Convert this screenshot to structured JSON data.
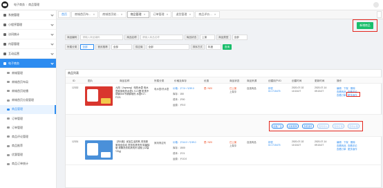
{
  "header": {
    "breadcrumb": [
      "电子商务",
      "商品管理"
    ]
  },
  "sidebar": {
    "items": [
      {
        "label": "系统管理"
      },
      {
        "label": "小程序管理"
      },
      {
        "label": "访问统计"
      },
      {
        "label": "内容管理"
      },
      {
        "label": "互动运营"
      },
      {
        "label": "电子商务"
      }
    ],
    "sub_items": [
      {
        "label": "商城管理"
      },
      {
        "label": "商城首页布局"
      },
      {
        "label": "商城首页轮播"
      },
      {
        "label": "商城首页分类管理"
      },
      {
        "label": "商品管理"
      },
      {
        "label": "订单管理"
      },
      {
        "label": "订单管理"
      },
      {
        "label": "商品评论管理"
      },
      {
        "label": "商品推荐"
      },
      {
        "label": "优惠管理"
      },
      {
        "label": "商品订单统计"
      }
    ]
  },
  "tabs": [
    {
      "label": "首页"
    },
    {
      "label": "商城首页布..."
    },
    {
      "label": "商城首页轮..."
    },
    {
      "label": "商品管理"
    },
    {
      "label": "订单管理"
    },
    {
      "label": "退货管理"
    },
    {
      "label": "商品评价..."
    }
  ],
  "toolbar": {
    "create_label": "新增商品"
  },
  "filters": {
    "code_label": "商品编码",
    "code_placeholder": "请输入商品编码",
    "name_label": "商品名称",
    "name_placeholder": "请输入商品名称",
    "status_label": "商品状态",
    "status_value": "上架",
    "type_label": "商品类型",
    "type_value": "全部",
    "recommend_label": "所属分类",
    "recommend_value": "全部",
    "first_label": "首页推荐",
    "first_value": "全部",
    "supplier_label": "供应商",
    "supplier_value": "全部",
    "sort_label": "排序方式",
    "sort_value": "年度",
    "search_label": "查询"
  },
  "list": {
    "title": "商品列表",
    "columns": [
      "ID",
      "图片",
      "商品名称",
      "所属分类",
      "价格及库存",
      "优惠",
      "商品状态",
      "商品来源",
      "创建用户/ID",
      "创建时间",
      "更新时间",
      "操作"
    ],
    "rows": [
      {
        "id": "12332",
        "name": "九阳（Joyoung）电热水壶 电水壶家用电热水壶1.7L口罩 防烫不锈钢304不锈钢电热 水壶K17-F221",
        "category": "电水壶/热水壶",
        "price": "价格：￥74～￥89.0",
        "stock": "库存：150",
        "cost": "成本：￥50",
        "fee": "运费：￥5.0",
        "discount": "是 / ¥20",
        "status": "已上架",
        "status2": "上架中",
        "source": "自选商品",
        "creator": "林悦",
        "creator_id": "ID:1715475",
        "created": "2020-07-02 10:15:27",
        "updated": "2020-07-14 09:15:27",
        "ops": [
          "编辑",
          "下架",
          "删除",
          "查看商品",
          "查看评论",
          "查看订单",
          "更多操作"
        ]
      },
      {
        "id": "12331",
        "name": "【年1款】优加生活的氧 洗衣服 家用全自动 洗衣机清洗剂 除菌除垢 滚筒洗衣机清洗剂 波轮 (12袋*20g)",
        "category": "家用清洁剂",
        "price": "价格：￥34.0～￥89.0",
        "stock": "库存：1500",
        "cost": "成本：￥21",
        "fee": "运费：￥10.0",
        "discount": "是 / ¥20",
        "status": "已上架",
        "status2": "上架中",
        "source": "自选商品",
        "creator": "林悦",
        "creator_id": "ID:1715475",
        "created": "2020-07-02 10:15:27",
        "updated": "2020-07-14 09:15:27",
        "ops": [
          "编辑",
          "下架",
          "删除",
          "查看商品",
          "查看评论",
          "查看订单",
          "更多操作"
        ]
      }
    ],
    "more_actions": [
      "设置广告",
      "设置推荐",
      "查看操作",
      "查询评价",
      "查询订单",
      "查询价格"
    ]
  }
}
